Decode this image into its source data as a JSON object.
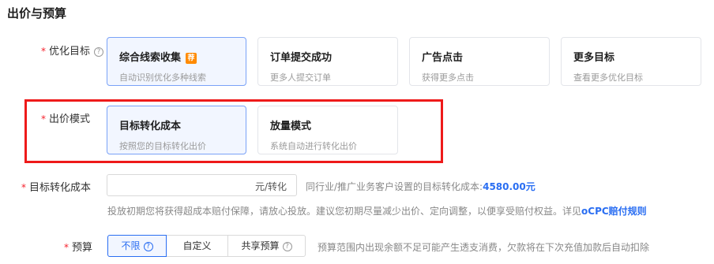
{
  "section": {
    "title": "出价与预算"
  },
  "optimization": {
    "label": "优化目标",
    "help": "?",
    "cards": [
      {
        "title": "综合线索收集",
        "desc": "自动识别优化多种线索",
        "badge": "荐"
      },
      {
        "title": "订单提交成功",
        "desc": "更多人提交订单"
      },
      {
        "title": "广告点击",
        "desc": "获得更多点击"
      },
      {
        "title": "更多目标",
        "desc": "查看更多优化目标"
      }
    ]
  },
  "bid_mode": {
    "label": "出价模式",
    "cards": [
      {
        "title": "目标转化成本",
        "desc": "按照您的目标转化出价"
      },
      {
        "title": "放量模式",
        "desc": "系统自动进行转化出价"
      }
    ]
  },
  "target_cost": {
    "label": "目标转化成本",
    "value": "",
    "suffix": "元/转化",
    "industry_text": "同行业/推广业务客户设置的目标转化成本:",
    "industry_value": "4580.00元",
    "note": "投放初期您将获得超成本赔付保障，请放心投放。建议您初期尽量减少出价、定向调整，以便享受赔付权益。详见",
    "note_link": "oCPC赔付规则"
  },
  "budget": {
    "label": "预算",
    "options": [
      "不限",
      "自定义",
      "共享预算"
    ],
    "help": "?",
    "hint": "预算范围内出现余额不足可能产生透支消费，欠款将在下次充值加款后自动扣除"
  },
  "colors": {
    "accent": "#2a6ef2",
    "highlight_box": "#ee1a1a",
    "badge": "#ff8a00",
    "required": "#f5222d"
  }
}
